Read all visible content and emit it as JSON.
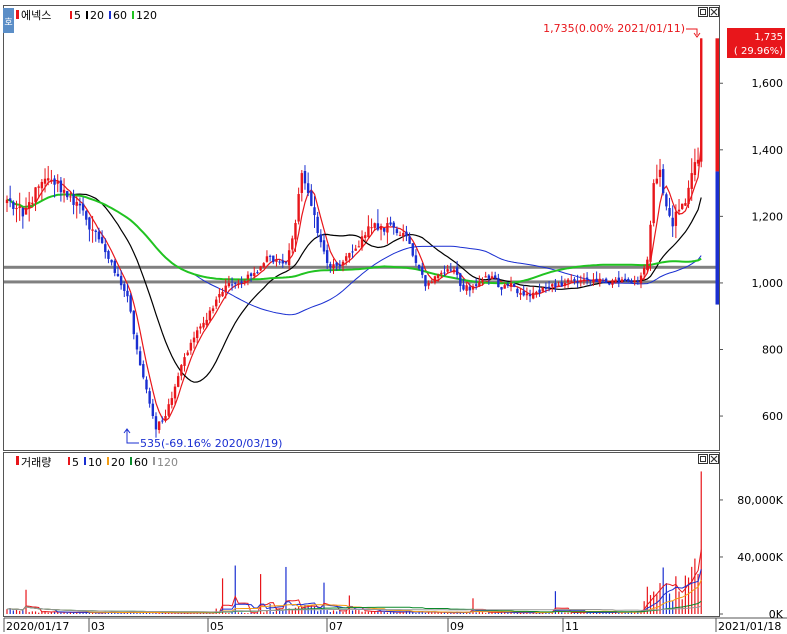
{
  "toolbar": {
    "left_button_label": "호",
    "price_panel_title": "에넥스",
    "price_ma_labels": [
      "5",
      "20",
      "60",
      "120"
    ],
    "volume_panel_title": "거래량",
    "volume_ma_labels": [
      "5",
      "10",
      "20",
      "60",
      "120"
    ]
  },
  "colors": {
    "up": "#e8161b",
    "down": "#1a2fd1",
    "ma5": "#e8161b",
    "ma20": "#000000",
    "ma60": "#1a2fd1",
    "ma120": "#21c321",
    "vma5": "#e8161b",
    "vma10": "#1a2fd1",
    "vma20": "#f39c12",
    "vma60": "#0a8a2a",
    "vma120": "#999999",
    "support_line": "#808080"
  },
  "chart_data": [
    {
      "type": "candlestick",
      "title": "에넥스",
      "y_ticks": [
        600,
        800,
        1000,
        1200,
        1400,
        1600
      ],
      "y_tick_labels": [
        "600",
        "800",
        "1,000",
        "1,200",
        "1,400",
        "1,600"
      ],
      "ylim": [
        510,
        1760
      ],
      "x_tick_labels": [
        "2020/01/17",
        "03",
        "05",
        "07",
        "09",
        "11",
        "2021/01/18"
      ],
      "horizontal_lines": [
        1047,
        1003
      ],
      "current_price_label": "1,735",
      "current_change_label": "( 29.96%)",
      "high_annotation": "1,735(0.00% 2021/01/11)",
      "low_annotation": "535(-69.16% 2020/03/19)",
      "anchors": [
        [
          0,
          1250
        ],
        [
          5,
          1200
        ],
        [
          10,
          1290
        ],
        [
          14,
          1310
        ],
        [
          20,
          1260
        ],
        [
          25,
          1190
        ],
        [
          30,
          1120
        ],
        [
          34,
          1030
        ],
        [
          38,
          960
        ],
        [
          41,
          800
        ],
        [
          44,
          680
        ],
        [
          47,
          560
        ],
        [
          50,
          600
        ],
        [
          54,
          720
        ],
        [
          58,
          820
        ],
        [
          62,
          880
        ],
        [
          66,
          950
        ],
        [
          70,
          1000
        ],
        [
          74,
          1000
        ],
        [
          78,
          1030
        ],
        [
          82,
          1080
        ],
        [
          85,
          1070
        ],
        [
          88,
          1060
        ],
        [
          91,
          1180
        ],
        [
          93,
          1330
        ],
        [
          95,
          1270
        ],
        [
          98,
          1150
        ],
        [
          101,
          1060
        ],
        [
          105,
          1050
        ],
        [
          108,
          1090
        ],
        [
          111,
          1110
        ],
        [
          114,
          1170
        ],
        [
          117,
          1160
        ],
        [
          120,
          1180
        ],
        [
          123,
          1150
        ],
        [
          126,
          1140
        ],
        [
          129,
          1060
        ],
        [
          132,
          990
        ],
        [
          135,
          1020
        ],
        [
          138,
          1030
        ],
        [
          141,
          1040
        ],
        [
          144,
          980
        ],
        [
          147,
          990
        ],
        [
          150,
          1010
        ],
        [
          153,
          1020
        ],
        [
          156,
          980
        ],
        [
          159,
          1000
        ],
        [
          162,
          970
        ],
        [
          165,
          960
        ],
        [
          168,
          970
        ],
        [
          171,
          985
        ],
        [
          174,
          995
        ],
        [
          177,
          1010
        ],
        [
          180,
          1000
        ],
        [
          183,
          1010
        ],
        [
          186,
          1005
        ],
        [
          189,
          1000
        ],
        [
          192,
          1010
        ],
        [
          195,
          1005
        ],
        [
          199,
          1003
        ],
        [
          202,
          1070
        ],
        [
          204,
          1300
        ],
        [
          206,
          1340
        ],
        [
          208,
          1230
        ],
        [
          210,
          1170
        ],
        [
          212,
          1220
        ],
        [
          214,
          1240
        ],
        [
          216,
          1330
        ],
        [
          218,
          1370
        ],
        [
          219,
          1735
        ]
      ],
      "ma_lines": [
        {
          "name": "5",
          "span": 5
        },
        {
          "name": "20",
          "span": 20
        },
        {
          "name": "60",
          "span": 60
        },
        {
          "name": "120",
          "span": 120
        }
      ]
    },
    {
      "type": "bar",
      "title": "거래량",
      "y_ticks": [
        0,
        40000,
        80000
      ],
      "y_tick_labels": [
        "0K",
        "40,000K",
        "80,000K"
      ],
      "ylim": [
        0,
        101000
      ],
      "volume_profile": [
        [
          0,
          3000
        ],
        [
          14,
          1200
        ],
        [
          40,
          1000
        ],
        [
          60,
          800
        ],
        [
          80,
          1100
        ],
        [
          85,
          3000
        ],
        [
          90,
          2500
        ],
        [
          95,
          5000
        ],
        [
          100,
          2500
        ],
        [
          120,
          1500
        ],
        [
          140,
          1200
        ],
        [
          180,
          1000
        ],
        [
          200,
          1500
        ],
        [
          202,
          15000
        ],
        [
          206,
          25000
        ],
        [
          210,
          18000
        ],
        [
          214,
          20000
        ],
        [
          218,
          30000
        ],
        [
          219,
          100000
        ]
      ],
      "spikes": [
        [
          6,
          17000
        ],
        [
          66,
          3800
        ],
        [
          68,
          25000
        ],
        [
          72,
          34000
        ],
        [
          80,
          28000
        ],
        [
          83,
          7000
        ],
        [
          88,
          33000
        ],
        [
          100,
          22000
        ],
        [
          108,
          13000
        ],
        [
          147,
          11000
        ],
        [
          173,
          16000
        ]
      ],
      "ma_lines": [
        {
          "name": "5",
          "span": 5
        },
        {
          "name": "10",
          "span": 10
        },
        {
          "name": "20",
          "span": 20
        },
        {
          "name": "60",
          "span": 60
        },
        {
          "name": "120",
          "span": 120
        }
      ]
    }
  ]
}
